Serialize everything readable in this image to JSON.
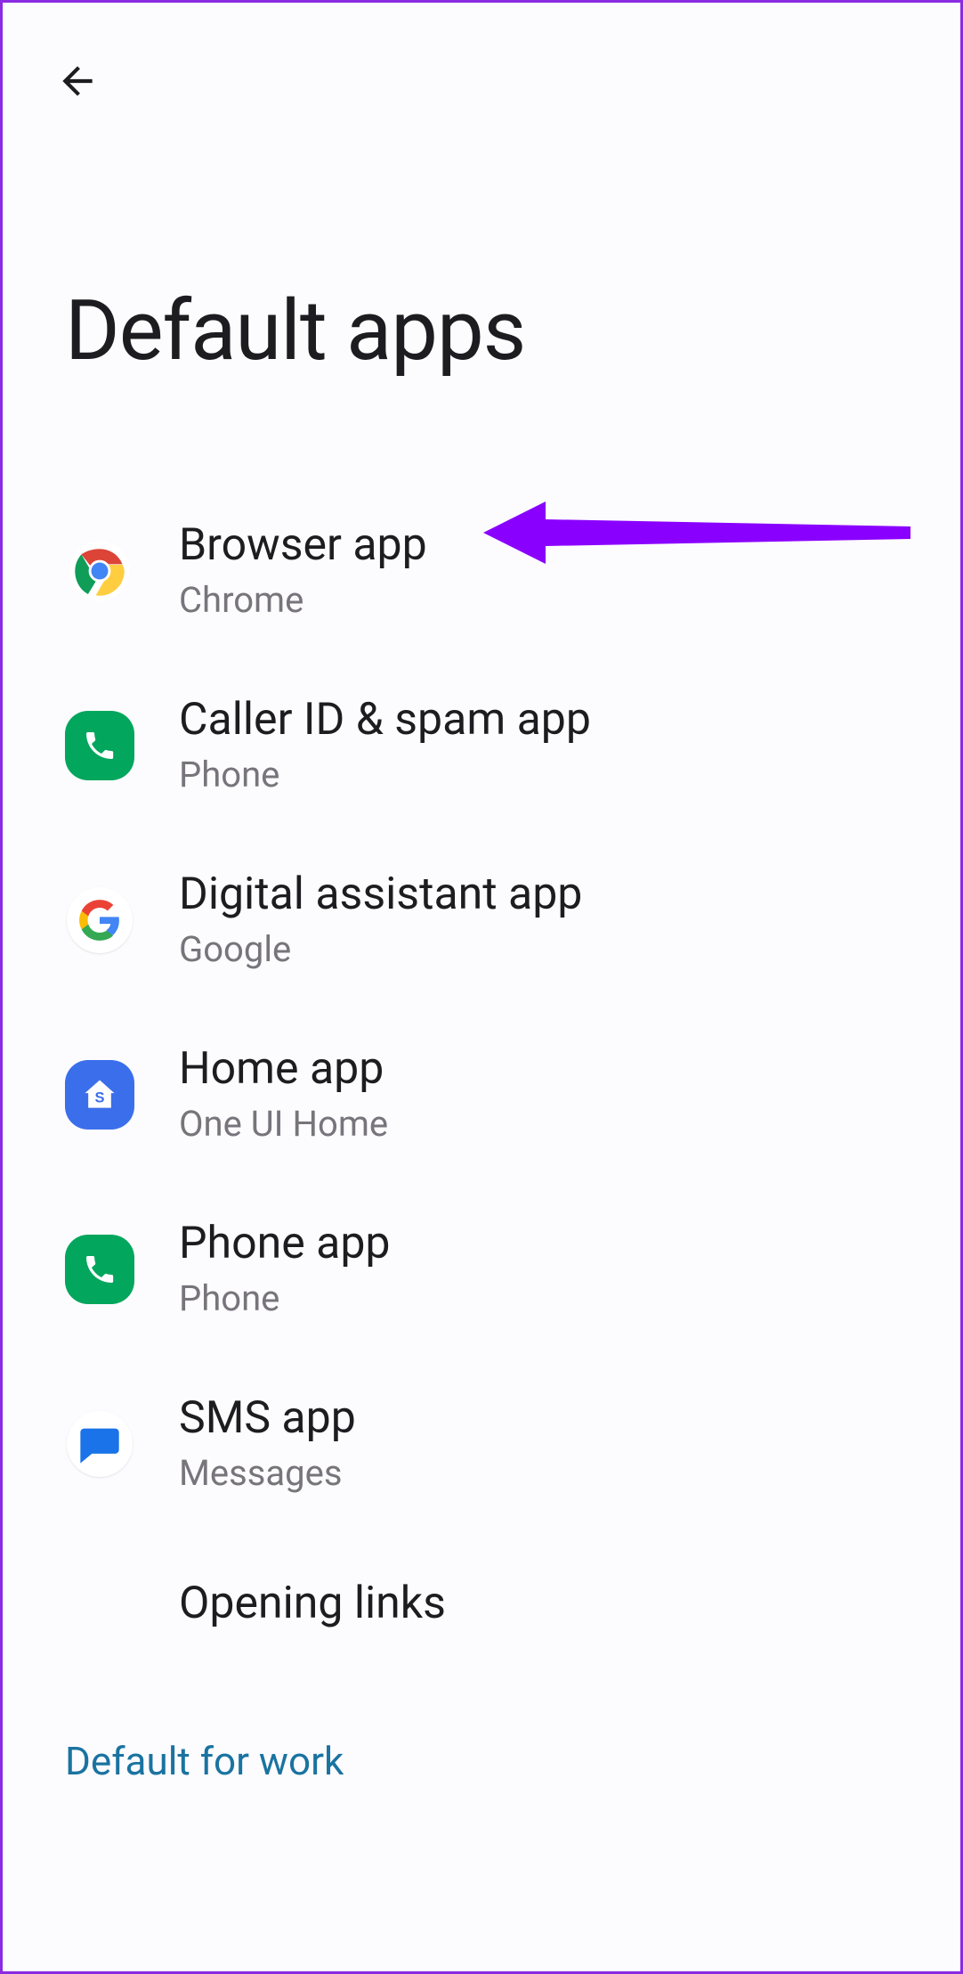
{
  "page": {
    "title": "Default apps"
  },
  "items": [
    {
      "name": "browser-app",
      "icon": "chrome-icon",
      "title": "Browser app",
      "subtitle": "Chrome"
    },
    {
      "name": "caller-id-spam-app",
      "icon": "phone-green-icon",
      "title": "Caller ID & spam app",
      "subtitle": "Phone"
    },
    {
      "name": "digital-assistant-app",
      "icon": "google-g-icon",
      "title": "Digital assistant app",
      "subtitle": "Google"
    },
    {
      "name": "home-app",
      "icon": "one-ui-home-icon",
      "title": "Home app",
      "subtitle": "One UI Home"
    },
    {
      "name": "phone-app",
      "icon": "phone-green-icon",
      "title": "Phone app",
      "subtitle": "Phone"
    },
    {
      "name": "sms-app",
      "icon": "messages-icon",
      "title": "SMS app",
      "subtitle": "Messages"
    },
    {
      "name": "opening-links",
      "icon": "",
      "title": "Opening links",
      "subtitle": ""
    }
  ],
  "footer": {
    "label": "Default for work"
  },
  "annotation": {
    "purple_arrow_target": "browser-app"
  }
}
